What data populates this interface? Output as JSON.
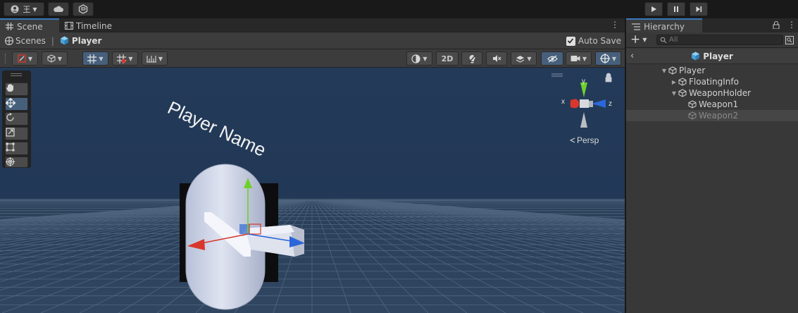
{
  "topbar": {
    "account_label": "王",
    "account_icon": "account-icon",
    "cloud_icon": "cloud-icon",
    "collab_icon": "collab-icon",
    "play_icon": "play-icon",
    "pause_icon": "pause-icon",
    "step_icon": "step-icon"
  },
  "scene_panel": {
    "tabs": [
      {
        "label": "Scene",
        "icon": "grid-icon",
        "active": true
      },
      {
        "label": "Timeline",
        "icon": "film-icon",
        "active": false
      }
    ],
    "breadcrumb": {
      "scenes_label": "Scenes",
      "separator": "|",
      "current": "Player"
    },
    "auto_save_label": "Auto Save",
    "auto_save_checked": true,
    "toolbar": {
      "mode_2d_label": "2D"
    },
    "viewport": {
      "world_label": "Player Name",
      "gizmo": {
        "x_label": "x",
        "y_label": "y",
        "z_label": "z",
        "persp_label": "Persp"
      }
    }
  },
  "hierarchy_panel": {
    "tab_label": "Hierarchy",
    "search_placeholder": "All",
    "header_title": "Player",
    "items": [
      {
        "label": "Player",
        "depth": 0,
        "expanded": true,
        "dim": false,
        "selected": false
      },
      {
        "label": "FloatingInfo",
        "depth": 1,
        "expanded": false,
        "dim": false,
        "selected": false
      },
      {
        "label": "WeaponHolder",
        "depth": 1,
        "expanded": true,
        "dim": false,
        "selected": false
      },
      {
        "label": "Weapon1",
        "depth": 2,
        "expanded": null,
        "dim": false,
        "selected": false
      },
      {
        "label": "Weapon2",
        "depth": 2,
        "expanded": null,
        "dim": true,
        "selected": true
      }
    ]
  },
  "colors": {
    "accent": "#3a79bb",
    "viewport_bg": "#223a58",
    "axis_x": "#d9372c",
    "axis_y": "#6fd02c",
    "axis_z": "#2c66d9"
  }
}
